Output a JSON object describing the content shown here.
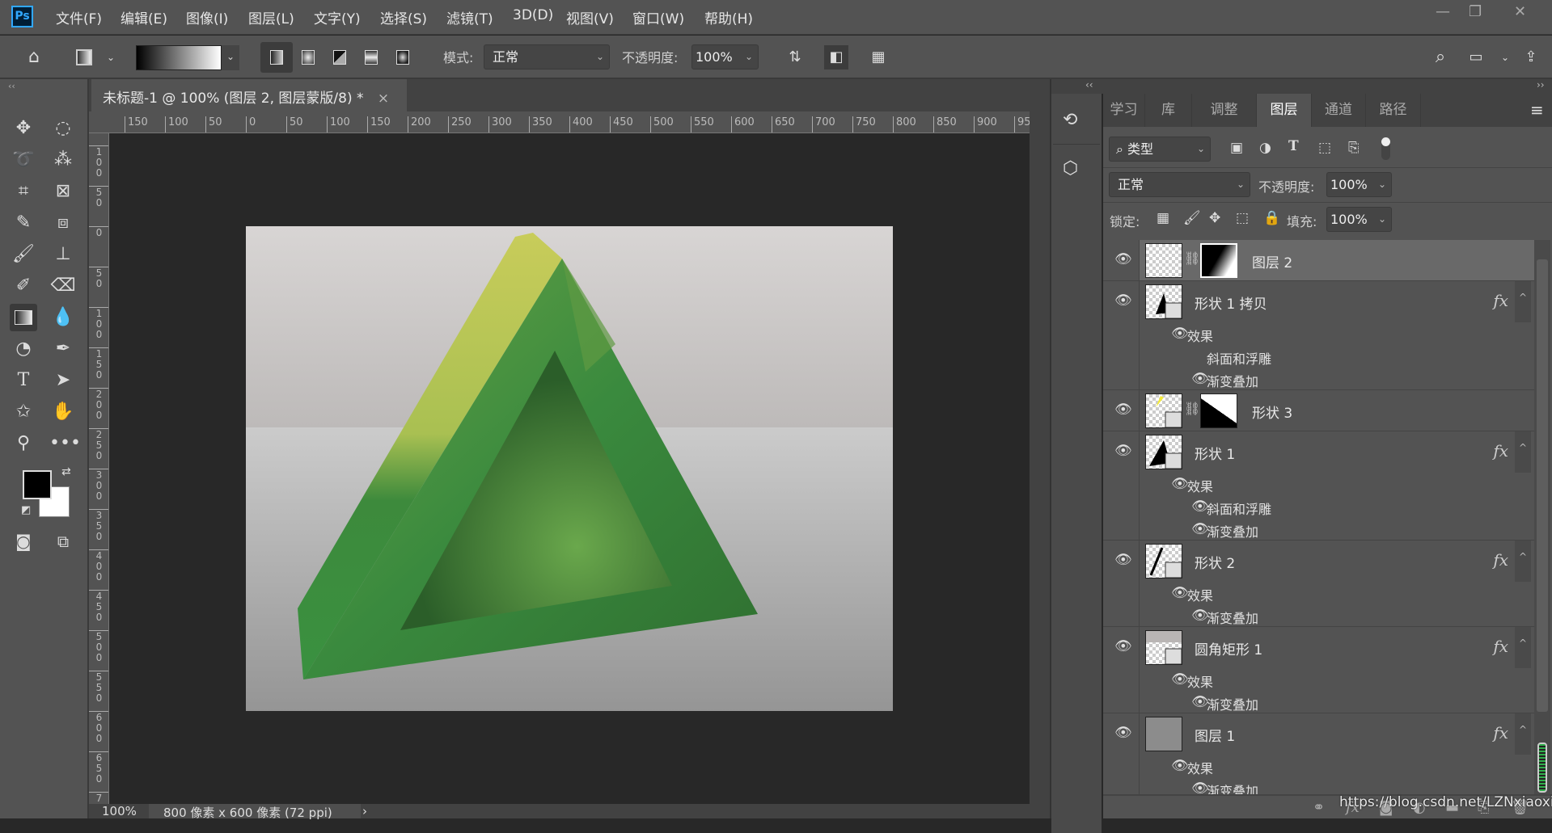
{
  "app": {
    "logo": "Ps"
  },
  "menu": [
    "文件(F)",
    "编辑(E)",
    "图像(I)",
    "图层(L)",
    "文字(Y)",
    "选择(S)",
    "滤镜(T)",
    "3D(D)",
    "视图(V)",
    "窗口(W)",
    "帮助(H)"
  ],
  "window_controls": {
    "minimize": "—",
    "restore": "❐",
    "close": "✕"
  },
  "options": {
    "mode_label": "模式:",
    "mode_value": "正常",
    "opacity_label": "不透明度:",
    "opacity_value": "100%",
    "gradient_types": [
      "linear",
      "radial",
      "angle",
      "reflected",
      "diamond"
    ]
  },
  "document": {
    "tab_title": "未标题-1 @ 100% (图层 2, 图层蒙版/8) *",
    "close": "×",
    "zoom": "100%",
    "info": "800 像素 x 600 像素 (72 ppi)",
    "info_arrow": "›"
  },
  "rulers": {
    "top": [
      "150",
      "100",
      "50",
      "0",
      "50",
      "100",
      "150",
      "200",
      "250",
      "300",
      "350",
      "400",
      "450",
      "500",
      "550",
      "600",
      "650",
      "700",
      "750",
      "800",
      "850",
      "900",
      "95"
    ],
    "left": [
      "1\n0\n0",
      "5\n0",
      "0",
      "5\n0",
      "1\n0\n0",
      "1\n5\n0",
      "2\n0\n0",
      "2\n5\n0",
      "3\n0\n0",
      "3\n5\n0",
      "4\n0\n0",
      "4\n5\n0",
      "5\n0\n0",
      "5\n5\n0",
      "6\n0\n0",
      "6\n5\n0",
      "7"
    ]
  },
  "colors": {
    "foreground": "#000000",
    "background": "#ffffff",
    "accent": "#31a8ff"
  },
  "panel": {
    "collapse_left": "‹‹",
    "collapse_right": "››",
    "tabs": [
      "学习",
      "库",
      "调整",
      "图层",
      "通道",
      "路径"
    ],
    "active_tab": "图层",
    "filter_value": "类型",
    "blend_value": "正常",
    "opacity_label": "不透明度:",
    "opacity_value": "100%",
    "lock_label": "锁定:",
    "fill_label": "填充:",
    "fill_value": "100%",
    "watermark": "https://blog.csdn.net/LZNxiaoxiang"
  },
  "layers": [
    {
      "name": "图层 2",
      "selected": true,
      "mask": true,
      "fx": false,
      "effects": []
    },
    {
      "name": "形状 1 拷贝",
      "fx": true,
      "effects_label": "效果",
      "effects": [
        {
          "name": "斜面和浮雕",
          "visible": false
        },
        {
          "name": "渐变叠加",
          "visible": true
        }
      ]
    },
    {
      "name": "形状 3",
      "mask": true,
      "fx": false,
      "effects": []
    },
    {
      "name": "形状 1",
      "fx": true,
      "effects_label": "效果",
      "effects": [
        {
          "name": "斜面和浮雕",
          "visible": true
        },
        {
          "name": "渐变叠加",
          "visible": true
        }
      ]
    },
    {
      "name": "形状 2",
      "fx": true,
      "effects_label": "效果",
      "effects": [
        {
          "name": "渐变叠加",
          "visible": true
        }
      ]
    },
    {
      "name": "圆角矩形 1",
      "fx": true,
      "effects_label": "效果",
      "effects": [
        {
          "name": "渐变叠加",
          "visible": true
        }
      ]
    },
    {
      "name": "图层 1",
      "fx": true,
      "effects_label": "效果",
      "effects": [
        {
          "name": "渐变叠加",
          "visible": true
        }
      ]
    }
  ],
  "fx_label": "fx"
}
